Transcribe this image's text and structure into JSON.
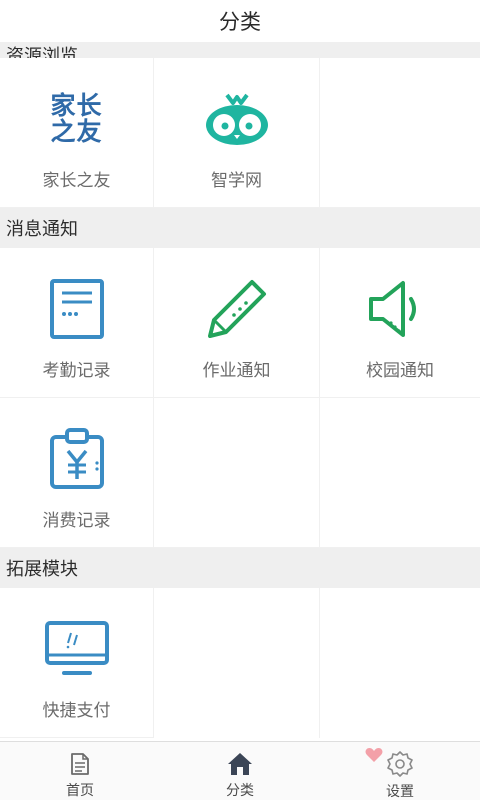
{
  "header": {
    "title": "分类"
  },
  "sections": [
    {
      "title": "资源浏览",
      "items": [
        {
          "label": "家长之友",
          "icon": "jiazhangzhiyou-logo",
          "logo_text_line1": "家长",
          "logo_text_line2": "之友"
        },
        {
          "label": "智学网",
          "icon": "owl-logo"
        }
      ]
    },
    {
      "title": "消息通知",
      "items": [
        {
          "label": "考勤记录",
          "icon": "document-icon"
        },
        {
          "label": "作业通知",
          "icon": "pencil-icon"
        },
        {
          "label": "校园通知",
          "icon": "speaker-icon"
        },
        {
          "label": "消费记录",
          "icon": "clipboard-yen-icon"
        }
      ]
    },
    {
      "title": "拓展模块",
      "items": [
        {
          "label": "快捷支付",
          "icon": "monitor-icon"
        }
      ]
    }
  ],
  "tabs": [
    {
      "label": "首页",
      "icon": "document-icon"
    },
    {
      "label": "分类",
      "icon": "home-icon",
      "active": true
    },
    {
      "label": "设置",
      "icon": "gear-icon",
      "badge_icon": "heart-icon"
    }
  ],
  "colors": {
    "blue": "#3a8cc4",
    "green": "#23a35a",
    "teal": "#1fb5a0",
    "navy": "#2f6aa8",
    "section_bg": "#efefef",
    "badge": "#f3a0a8"
  }
}
